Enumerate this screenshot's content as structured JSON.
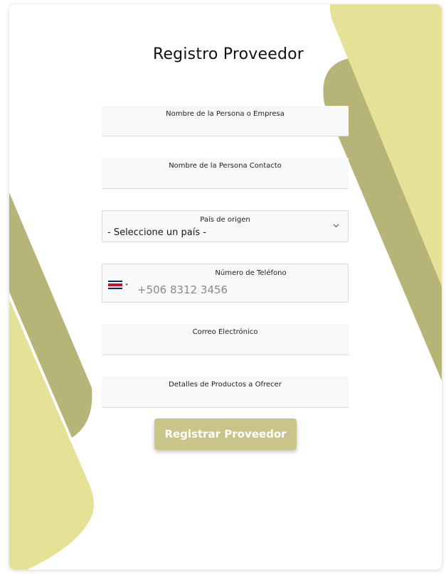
{
  "form": {
    "title": "Registro Proveedor",
    "fields": {
      "company_name": {
        "label": "Nombre de la Persona o Empresa",
        "value": ""
      },
      "contact_name": {
        "label": "Nombre de la Persona Contacto",
        "value": ""
      },
      "country": {
        "label": "País de origen",
        "selected": "- Seleccione un país -"
      },
      "phone": {
        "label": "Número de Teléfono",
        "placeholder": "+506 8312 3456",
        "flag": "costa-rica-flag-icon"
      },
      "email": {
        "label": "Correo Electrónico",
        "value": ""
      },
      "product_details": {
        "label": "Detalles de Productos a Ofrecer",
        "value": ""
      }
    },
    "submit_label": "Registrar Proveedor"
  },
  "colors": {
    "accent_light": "#e5e196",
    "accent_dark": "#b6b477",
    "button": "#c9c58a"
  }
}
